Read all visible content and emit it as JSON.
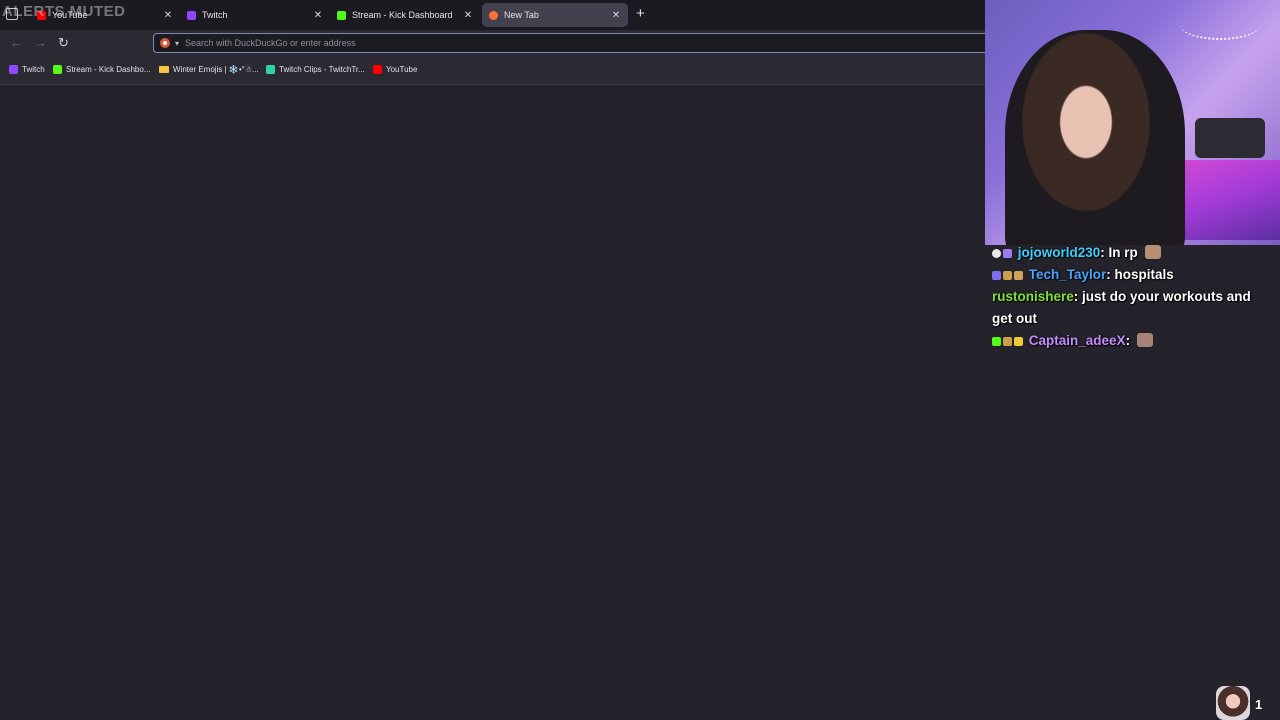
{
  "overlay": {
    "alerts_muted": "ALERTS MUTED"
  },
  "tabs": [
    {
      "title": "YouTube",
      "favicon": "youtube-icon",
      "color": "#ff0000",
      "active": false
    },
    {
      "title": "Twitch",
      "favicon": "twitch-icon",
      "color": "#9146ff",
      "active": false
    },
    {
      "title": "Stream - Kick Dashboard",
      "favicon": "kick-icon",
      "color": "#53fc18",
      "active": false
    },
    {
      "title": "New Tab",
      "favicon": "firefox-icon",
      "color": "#ff7139",
      "active": true
    }
  ],
  "urlbar": {
    "placeholder": "Search with DuckDuckGo or enter address",
    "value": ""
  },
  "bookmarks": [
    {
      "label": "Twitch",
      "icon": "twitch-icon",
      "color": "#9146ff"
    },
    {
      "label": "Stream - Kick Dashbo...",
      "icon": "kick-icon",
      "color": "#53fc18"
    },
    {
      "label": "Winter Emojis | ❄️•°☃...",
      "icon": "folder-icon",
      "color": "#f6c342"
    },
    {
      "label": "Twitch Clips - TwitchTr...",
      "icon": "twitchtracker-icon",
      "color": "#2ed3a2"
    },
    {
      "label": "YouTube",
      "icon": "youtube-icon",
      "color": "#ff0000"
    }
  ],
  "chat": [
    {
      "user": "jojoworld230",
      "user_color": "#3fd0ff",
      "message": "In rp"
    },
    {
      "user": "Tech_Taylor",
      "user_color": "#4aa3ff",
      "message": "hospitals"
    },
    {
      "user": "rustonishere",
      "user_color": "#7fe23a",
      "message": "just do your workouts and get out"
    },
    {
      "user": "Captain_adeeX",
      "user_color": "#c68cff",
      "message": ""
    }
  ],
  "viewers": {
    "count": "1"
  }
}
